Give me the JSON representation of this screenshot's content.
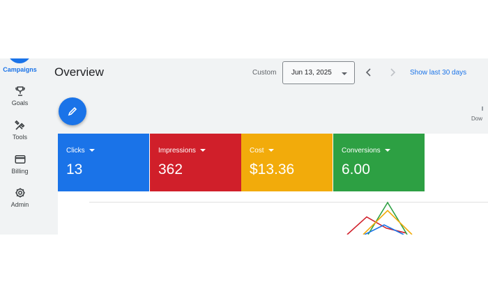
{
  "nav": {
    "items": [
      {
        "label": "Campaigns"
      },
      {
        "label": "Goals"
      },
      {
        "label": "Tools"
      },
      {
        "label": "Billing"
      },
      {
        "label": "Admin"
      }
    ]
  },
  "header": {
    "title": "Overview",
    "range_label": "Custom",
    "date_value": "Jun 13, 2025",
    "show_last_label": "Show last 30 days"
  },
  "toolbar": {
    "download_partial": "Dow"
  },
  "metrics": [
    {
      "label": "Clicks",
      "value": "13",
      "color": "#1a73e8"
    },
    {
      "label": "Impressions",
      "value": "362",
      "color": "#d01f2a"
    },
    {
      "label": "Cost",
      "value": "$13.36",
      "color": "#f2ab0b"
    },
    {
      "label": "Conversions",
      "value": "6.00",
      "color": "#2da043"
    }
  ],
  "icons": {
    "goals": "trophy-icon",
    "tools": "tools-icon",
    "billing": "credit-card-icon",
    "admin": "gear-icon",
    "edit": "pencil-icon"
  },
  "chart_data": {
    "type": "line",
    "series": [
      {
        "color": "#d01f2a",
        "values": [
          0,
          0.55,
          0.2,
          0.05
        ]
      },
      {
        "color": "#2da043",
        "values": [
          0,
          1.0,
          0
        ]
      },
      {
        "color": "#f2ab0b",
        "values": [
          0,
          0.75,
          0
        ]
      },
      {
        "color": "#1a73e8",
        "values": [
          0,
          0.3,
          0
        ]
      }
    ]
  }
}
